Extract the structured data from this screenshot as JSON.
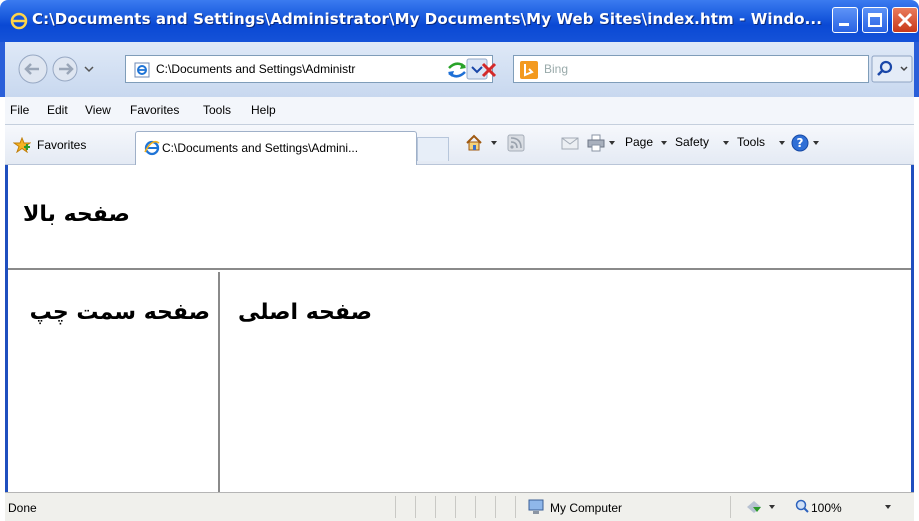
{
  "window": {
    "title": "C:\\Documents and Settings\\Administrator\\My Documents\\My Web Sites\\index.htm - Windo..."
  },
  "address_bar": {
    "url": "C:\\Documents and Settings\\Administr",
    "search_placeholder": "Bing"
  },
  "menu": {
    "items": [
      "File",
      "Edit",
      "View",
      "Favorites",
      "Tools",
      "Help"
    ]
  },
  "command_bar": {
    "favorites_label": "Favorites",
    "tab_label": "C:\\Documents and Settings\\Admini...",
    "page_label": "Page",
    "safety_label": "Safety",
    "tools_label": "Tools"
  },
  "frames": {
    "top_text": "صفحه بالا",
    "left_text": "صفحه سمت چپ",
    "main_text": "صفحه اصلی"
  },
  "status_bar": {
    "status": "Done",
    "zone": "My Computer",
    "zoom": "100%"
  },
  "colors": {
    "titlebar": "#0a49d4",
    "content_border": "#1f4fbf",
    "frame_divider": "#8a8a8a"
  },
  "icons": {
    "title": "ie-logo-icon",
    "back": "back-arrow-icon",
    "forward": "forward-arrow-icon",
    "page": "ie-page-icon",
    "refresh": "refresh-icon",
    "stop": "stop-icon",
    "search_provider": "bing-icon",
    "search_go": "search-icon",
    "favorites": "favorites-star-icon",
    "home": "home-icon",
    "feeds": "feeds-icon",
    "mail": "mail-icon",
    "print": "print-icon",
    "help": "help-icon",
    "zone": "computer-icon",
    "protected_mode": "protected-mode-icon",
    "zoom": "zoom-icon"
  }
}
